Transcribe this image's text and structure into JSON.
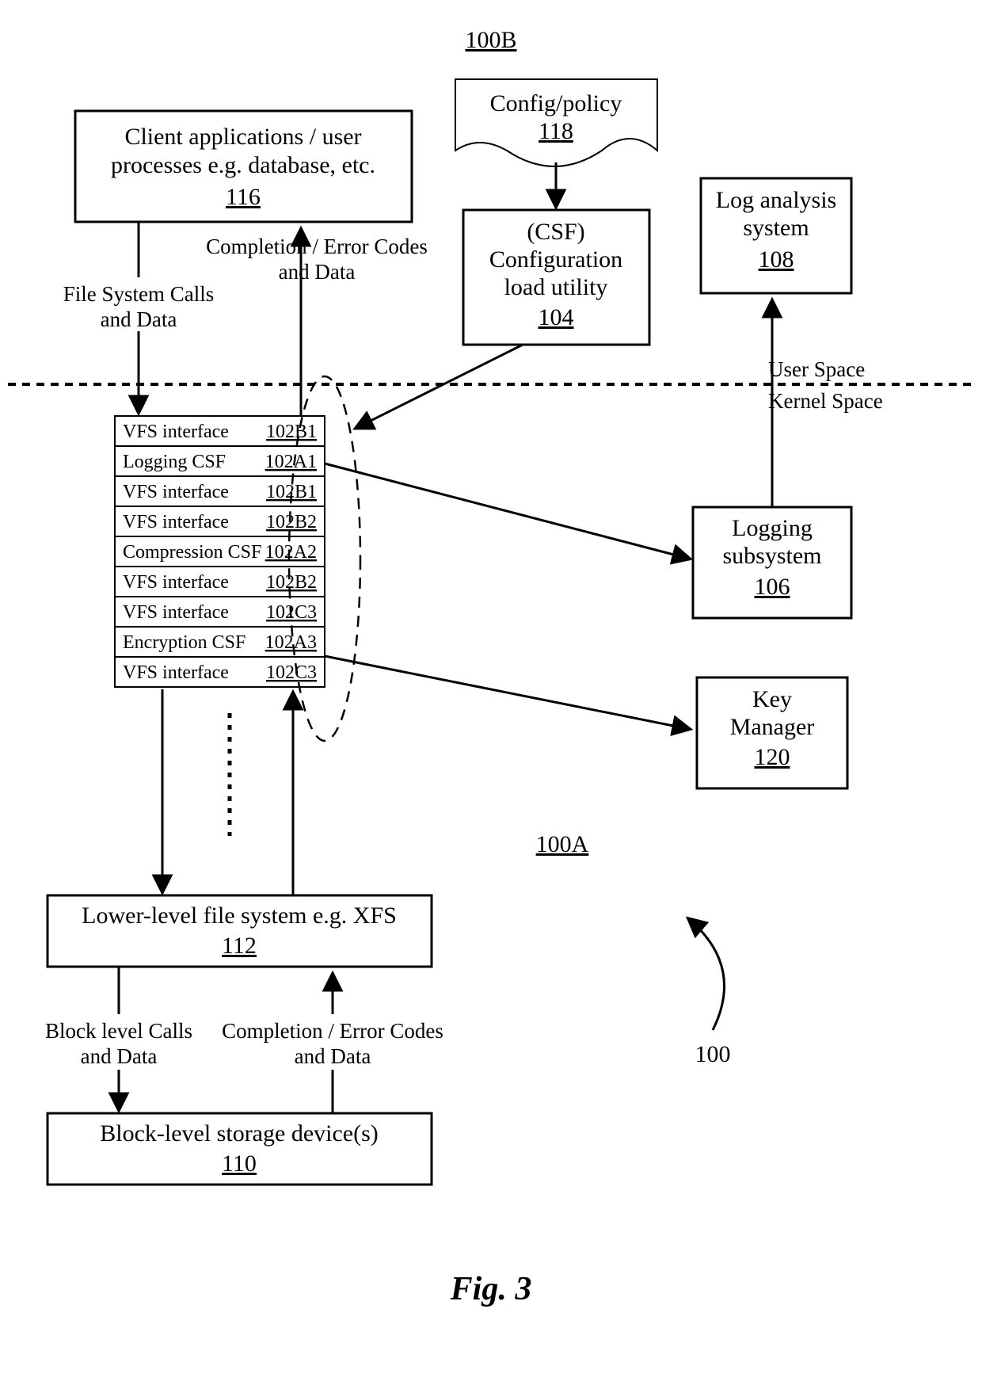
{
  "figure": {
    "caption": "Fig. 3",
    "ref_top": "100B",
    "ref_mid": "100A",
    "ref_arrow": "100",
    "user_space_label": "User Space",
    "kernel_space_label": "Kernel Space"
  },
  "boxes": {
    "client": {
      "line1": "Client applications / user",
      "line2": "processes e.g. database, etc.",
      "ref": "116"
    },
    "config_policy": {
      "label": "Config/policy",
      "ref": "118"
    },
    "csf_load": {
      "line1": "(CSF)",
      "line2": "Configuration",
      "line3": "load utility",
      "ref": "104"
    },
    "log_analysis": {
      "line1": "Log analysis",
      "line2": "system",
      "ref": "108"
    },
    "logging_sub": {
      "line1": "Logging",
      "line2": "subsystem",
      "ref": "106"
    },
    "key_mgr": {
      "line1": "Key",
      "line2": "Manager",
      "ref": "120"
    },
    "lower_fs": {
      "label": "Lower-level file system e.g. XFS",
      "ref": "112"
    },
    "block_dev": {
      "label": "Block-level storage device(s)",
      "ref": "110"
    }
  },
  "stack": [
    {
      "label": "VFS interface",
      "ref": "102B1"
    },
    {
      "label": "Logging CSF",
      "ref": "102A1"
    },
    {
      "label": "VFS interface",
      "ref": "102B1"
    },
    {
      "label": "VFS interface",
      "ref": "102B2"
    },
    {
      "label": "Compression CSF",
      "ref": "102A2"
    },
    {
      "label": "VFS interface",
      "ref": "102B2"
    },
    {
      "label": "VFS interface",
      "ref": "102C3"
    },
    {
      "label": "Encryption CSF",
      "ref": "102A3"
    },
    {
      "label": "VFS interface",
      "ref": "102C3"
    }
  ],
  "labels": {
    "fs_calls": {
      "line1": "File System Calls",
      "line2": "and Data"
    },
    "comp_err_top": {
      "line1": "Completion / Error Codes",
      "line2": "and Data"
    },
    "block_calls": {
      "line1": "Block level Calls",
      "line2": "and Data"
    },
    "comp_err_bot": {
      "line1": "Completion / Error Codes",
      "line2": "and Data"
    }
  }
}
